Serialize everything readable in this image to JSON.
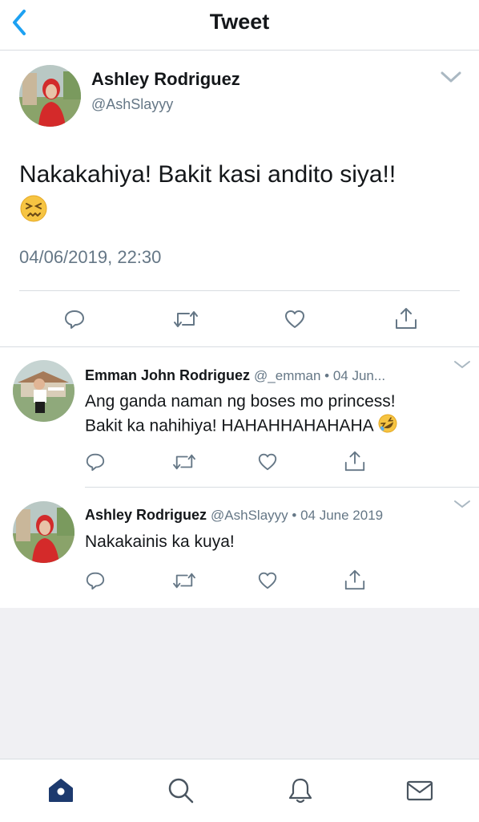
{
  "nav": {
    "title": "Tweet",
    "back_icon": "chevron-left-icon"
  },
  "colors": {
    "accent": "#1da1f2",
    "muted": "#657786",
    "text": "#14171a",
    "separator": "#d8dde1",
    "background_gray": "#f0f0f3",
    "home_active": "#1d3a6e"
  },
  "main_tweet": {
    "name": "Ashley Rodriguez",
    "handle": "@AshSlayyy",
    "text": "Nakakahiya! Bakit kasi andito siya!!",
    "emoji": "confounded-face-icon",
    "timestamp": "04/06/2019, 22:30",
    "actions": [
      "reply-icon",
      "retweet-icon",
      "like-icon",
      "share-icon"
    ]
  },
  "replies": [
    {
      "name": "Emman John Rodriguez",
      "meta": "@_emman • 04 Jun...",
      "text_line1": "Ang ganda naman ng boses mo princess!",
      "text_line2": "Bakit ka nahihiya! HAHAHHAHAHAHA",
      "emoji": "rolling-on-floor-laughing-icon"
    },
    {
      "name": "Ashley Rodriguez",
      "meta": "@AshSlayyy • 04 June 2019",
      "text_line1": "Nakakainis ka kuya!"
    }
  ],
  "tabbar": {
    "items": [
      "home-icon",
      "search-icon",
      "notifications-icon",
      "messages-icon"
    ]
  }
}
